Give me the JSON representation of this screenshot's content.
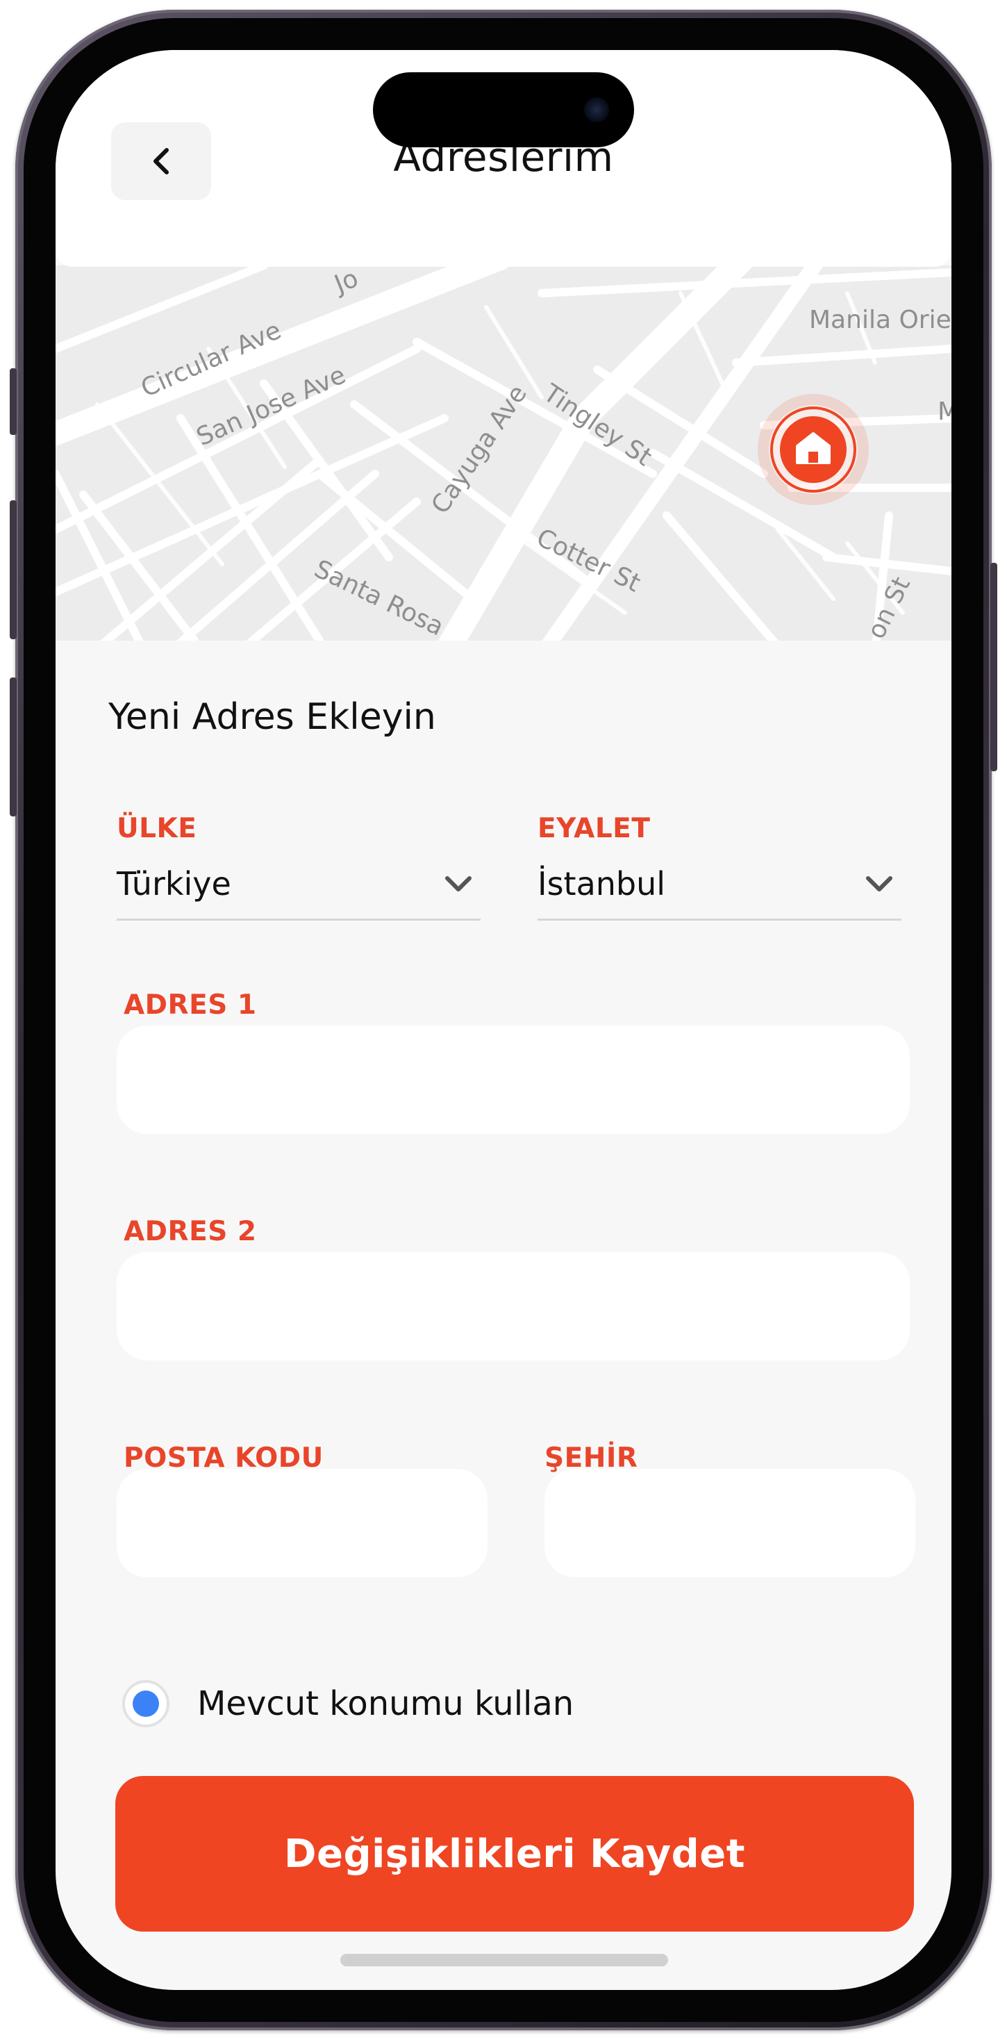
{
  "header": {
    "title": "Adreslerim"
  },
  "map": {
    "streets": [
      "Circular Ave",
      "Jo",
      "San Jose Ave",
      "Manila Orie",
      "M",
      "Tingley St",
      "Cayuga Ave",
      "Cotter St",
      "Santa Rosa",
      "on St"
    ]
  },
  "form": {
    "title": "Yeni Adres Ekleyin",
    "country": {
      "label": "ÜLKE",
      "value": "Türkiye"
    },
    "state": {
      "label": "EYALET",
      "value": "İstanbul"
    },
    "address1": {
      "label": "ADRES 1",
      "value": ""
    },
    "address2": {
      "label": "ADRES 2",
      "value": ""
    },
    "postal": {
      "label": "POSTA KODU",
      "value": ""
    },
    "city": {
      "label": "ŞEHİR",
      "value": ""
    },
    "use_location": {
      "label": "Mevcut konumu kullan",
      "checked": true
    },
    "save_label": "Değişiklikleri Kaydet"
  },
  "colors": {
    "accent": "#ef4523",
    "label": "#e8452a",
    "radio": "#3b82f6"
  },
  "icons": {
    "back": "chevron-left-icon",
    "pin": "home-pin-icon",
    "dropdown": "chevron-down-icon"
  }
}
